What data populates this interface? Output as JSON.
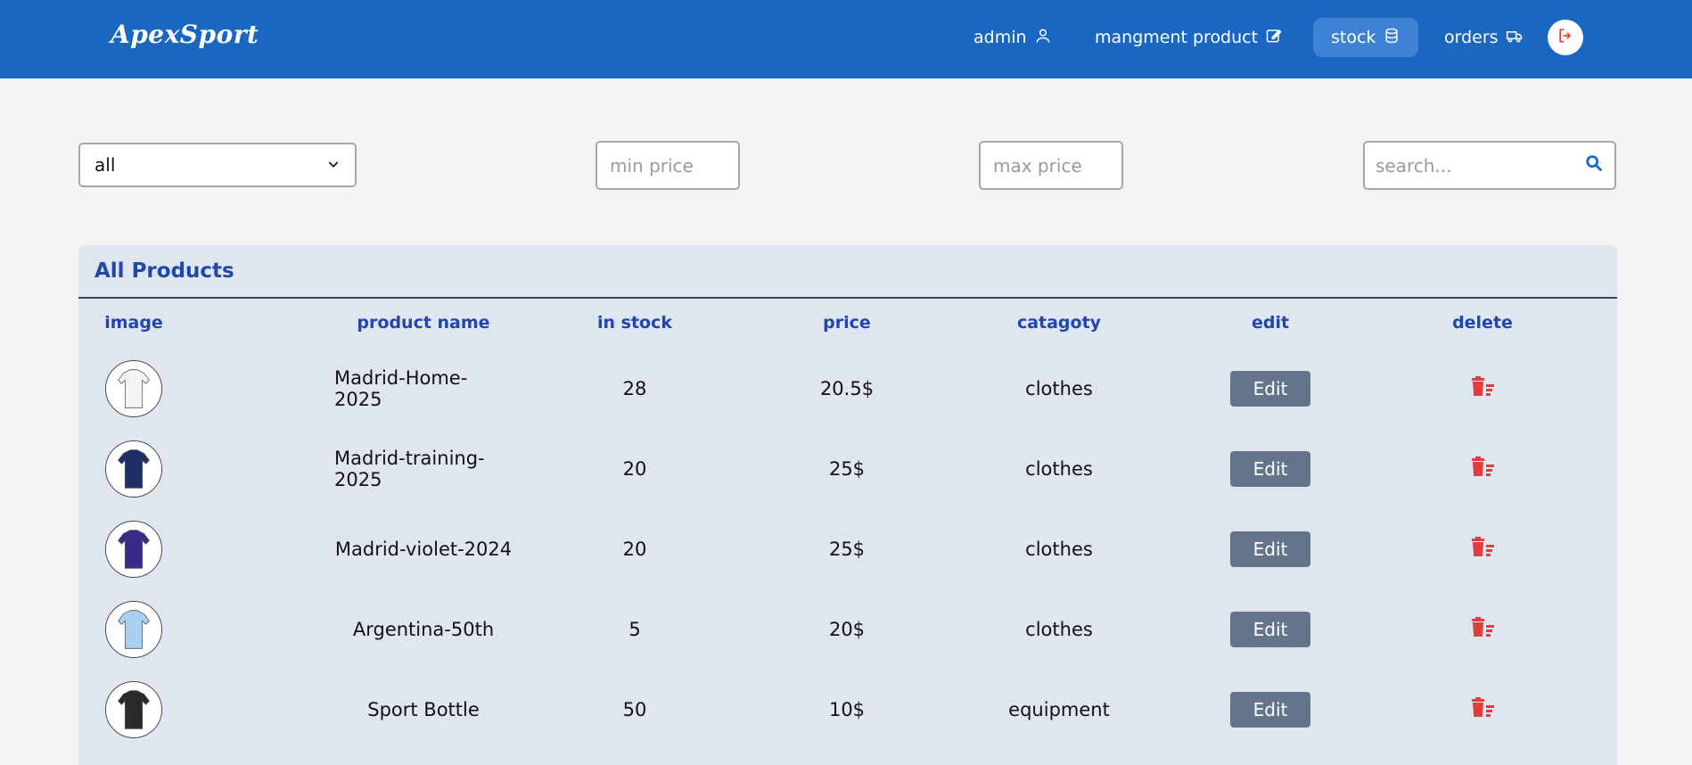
{
  "header": {
    "brand": "ApexSport",
    "nav": [
      {
        "label": "admin",
        "icon": "user-icon"
      },
      {
        "label": "mangment product",
        "icon": "edit-square-icon"
      },
      {
        "label": "stock",
        "icon": "database-icon",
        "active": true
      },
      {
        "label": "orders",
        "icon": "truck-icon"
      }
    ],
    "logout_icon": "logout-icon"
  },
  "filters": {
    "category_selected": "all",
    "min_price_placeholder": "min price",
    "max_price_placeholder": "max price",
    "search_placeholder": "search..."
  },
  "table": {
    "title": "All Products",
    "columns": [
      "image",
      "product name",
      "in stock",
      "price",
      "catagoty",
      "edit",
      "delete"
    ],
    "edit_label": "Edit",
    "rows": [
      {
        "name": "Madrid-Home-2025",
        "stock": "28",
        "price": "20.5$",
        "category": "clothes",
        "thumb_color": "#f4f4f6"
      },
      {
        "name": "Madrid-training-2025",
        "stock": "20",
        "price": "25$",
        "category": "clothes",
        "thumb_color": "#1d2f66"
      },
      {
        "name": "Madrid-violet-2024",
        "stock": "20",
        "price": "25$",
        "category": "clothes",
        "thumb_color": "#3a2a8a"
      },
      {
        "name": "Argentina-50th",
        "stock": "5",
        "price": "20$",
        "category": "clothes",
        "thumb_color": "#a8d0f0"
      },
      {
        "name": "Sport Bottle",
        "stock": "50",
        "price": "10$",
        "category": "equipment",
        "thumb_color": "#2a2a2a"
      }
    ]
  },
  "colors": {
    "header_bg": "#1a67c2",
    "accent": "#2146b0",
    "delete": "#e23c3c",
    "edit_button": "#64748b"
  }
}
